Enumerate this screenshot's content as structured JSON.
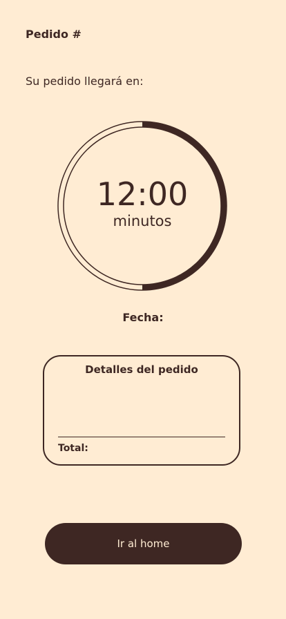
{
  "header": {
    "order_title": "Pedido #"
  },
  "arrival": {
    "text": "Su pedido llegará en:"
  },
  "timer": {
    "time": "12:00",
    "unit": "minutos",
    "progress": 0.5
  },
  "date": {
    "label": "Fecha:"
  },
  "details": {
    "title": "Detalles del pedido",
    "total_label": "Total:"
  },
  "actions": {
    "home_label": "Ir al home"
  },
  "colors": {
    "background": "#ffecd3",
    "primary": "#3e2723",
    "button_text": "#ffecd3"
  }
}
